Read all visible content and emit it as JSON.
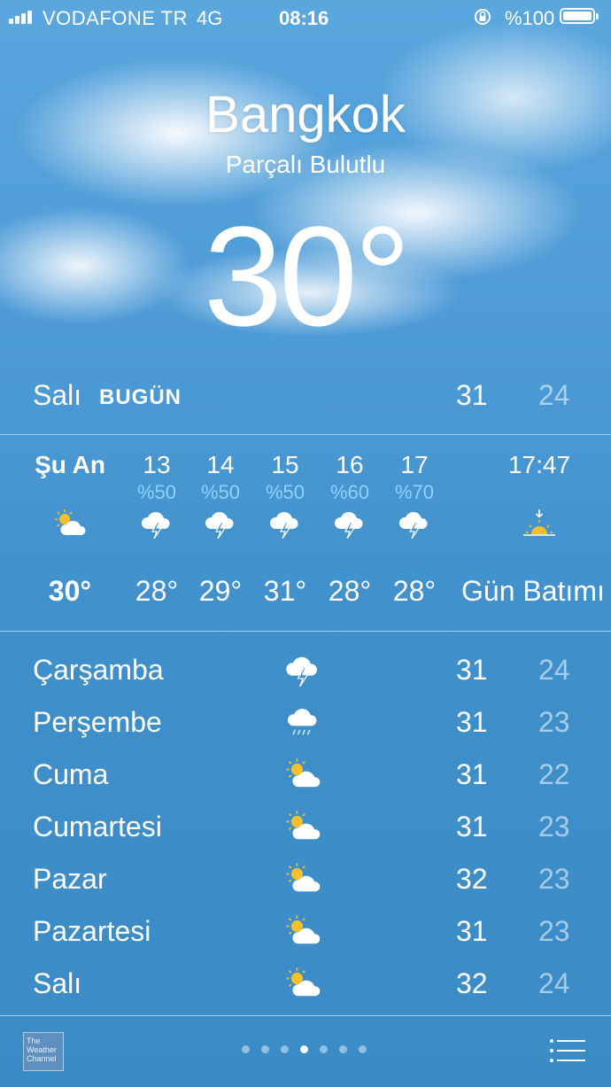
{
  "status_bar": {
    "carrier": "VODAFONE TR",
    "network": "4G",
    "time": "08:16",
    "battery": "%100",
    "battery_level": 1.0
  },
  "location": {
    "city": "Bangkok",
    "condition": "Parçalı Bulutlu",
    "temperature": "30°"
  },
  "today": {
    "day": "Salı",
    "tag": "BUGÜN",
    "high": "31",
    "low": "24"
  },
  "hourly": [
    {
      "time": "Şu An",
      "precip": "",
      "icon": "partly-cloudy-icon",
      "temp": "30°"
    },
    {
      "time": "13",
      "precip": "%50",
      "icon": "thunderstorm-icon",
      "temp": "28°"
    },
    {
      "time": "14",
      "precip": "%50",
      "icon": "thunderstorm-icon",
      "temp": "29°"
    },
    {
      "time": "15",
      "precip": "%50",
      "icon": "thunderstorm-icon",
      "temp": "31°"
    },
    {
      "time": "16",
      "precip": "%60",
      "icon": "thunderstorm-icon",
      "temp": "28°"
    },
    {
      "time": "17",
      "precip": "%70",
      "icon": "thunderstorm-icon",
      "temp": "28°"
    },
    {
      "time": "17:47",
      "precip": "",
      "icon": "sunset-icon",
      "temp": "Gün Batımı"
    }
  ],
  "daily": [
    {
      "day": "Çarşamba",
      "icon": "thunderstorm-icon",
      "high": "31",
      "low": "24"
    },
    {
      "day": "Perşembe",
      "icon": "rain-icon",
      "high": "31",
      "low": "23"
    },
    {
      "day": "Cuma",
      "icon": "partly-cloudy-icon",
      "high": "31",
      "low": "22"
    },
    {
      "day": "Cumartesi",
      "icon": "partly-cloudy-icon",
      "high": "31",
      "low": "23"
    },
    {
      "day": "Pazar",
      "icon": "partly-cloudy-icon",
      "high": "32",
      "low": "23"
    },
    {
      "day": "Pazartesi",
      "icon": "partly-cloudy-icon",
      "high": "31",
      "low": "23"
    },
    {
      "day": "Salı",
      "icon": "partly-cloudy-icon",
      "high": "32",
      "low": "24"
    }
  ],
  "footer": {
    "logo_text": "The Weather Channel",
    "page_count": 7,
    "active_page": 4
  },
  "colors": {
    "sky": "#4d9ad6",
    "precip": "#8fd3ff",
    "sun": "#f5c12b"
  }
}
